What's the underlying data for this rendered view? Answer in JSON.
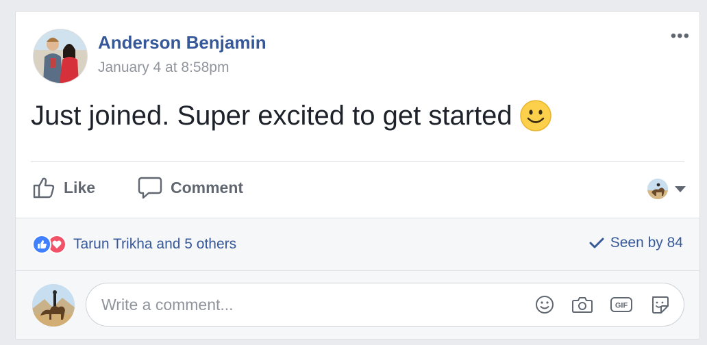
{
  "post": {
    "author": "Anderson Benjamin",
    "timestamp": "January 4 at 8:58pm",
    "text": "Just joined. Super excited to get started",
    "more_label": "•••"
  },
  "actions": {
    "like": "Like",
    "comment": "Comment"
  },
  "reactions": {
    "names": "Tarun Trikha and 5 others",
    "seen": "Seen by 84"
  },
  "composer": {
    "placeholder": "Write a comment..."
  },
  "colors": {
    "link": "#365899",
    "like_blue": "#4080ff",
    "love_red": "#f25268"
  }
}
